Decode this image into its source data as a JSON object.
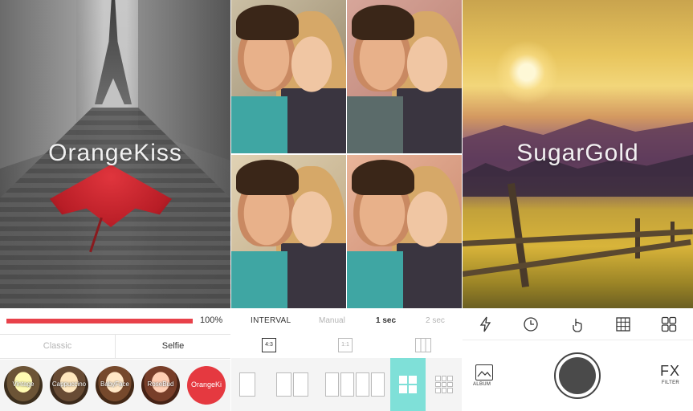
{
  "panel1": {
    "overlay_title": "OrangeKiss",
    "progress": {
      "value": 1.0,
      "label": "100%"
    },
    "modes": [
      {
        "label": "Classic",
        "selected": false
      },
      {
        "label": "Selfie",
        "selected": true
      }
    ],
    "filters": [
      {
        "label": "Vintage",
        "selected": false
      },
      {
        "label": "Cappuccino",
        "selected": false
      },
      {
        "label": "BabyFace",
        "selected": false
      },
      {
        "label": "RoseBud",
        "selected": false
      },
      {
        "label": "OrangeKi",
        "selected": true
      }
    ],
    "colors": {
      "accent": "#e53940"
    }
  },
  "panel2": {
    "interval": {
      "title": "INTERVAL",
      "options": [
        "Manual",
        "1 sec",
        "2 sec"
      ],
      "selected": "1 sec"
    },
    "ratios": [
      "4:3",
      "1:1",
      "grid"
    ],
    "selected_ratio": "4:3",
    "layouts": [
      "single",
      "double",
      "quad-strip",
      "2x2",
      "3x3"
    ],
    "selected_layout": "2x2",
    "colors": {
      "selected_layout_bg": "#7fe0d8"
    }
  },
  "panel3": {
    "overlay_title": "SugarGold",
    "tools": [
      "flash-icon",
      "timer-icon",
      "touch-icon",
      "grid-icon",
      "layout-icon"
    ],
    "album_label": "ALBUM",
    "fx_label": "FX",
    "fx_sublabel": "FILTER"
  }
}
